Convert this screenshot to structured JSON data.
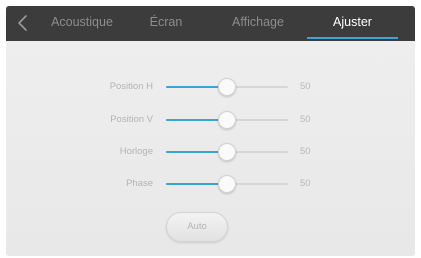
{
  "colors": {
    "accent": "#3aa3d8",
    "topbar": "#3c3c3c",
    "tab_inactive": "#8d8d8d",
    "tab_active": "#ffffff"
  },
  "header": {
    "back_icon": "chevron-left-icon",
    "tabs": [
      {
        "label": "Acoustique",
        "active": false
      },
      {
        "label": "Écran",
        "active": false
      },
      {
        "label": "Affichage",
        "active": false
      },
      {
        "label": "Ajuster",
        "active": true
      }
    ]
  },
  "settings": {
    "rows": [
      {
        "label": "Position H",
        "value": "50",
        "level": 0.5
      },
      {
        "label": "Position V",
        "value": "50",
        "level": 0.5
      },
      {
        "label": "Horloge",
        "value": "50",
        "level": 0.5
      },
      {
        "label": "Phase",
        "value": "50",
        "level": 0.5
      }
    ],
    "auto_label": "Auto"
  }
}
